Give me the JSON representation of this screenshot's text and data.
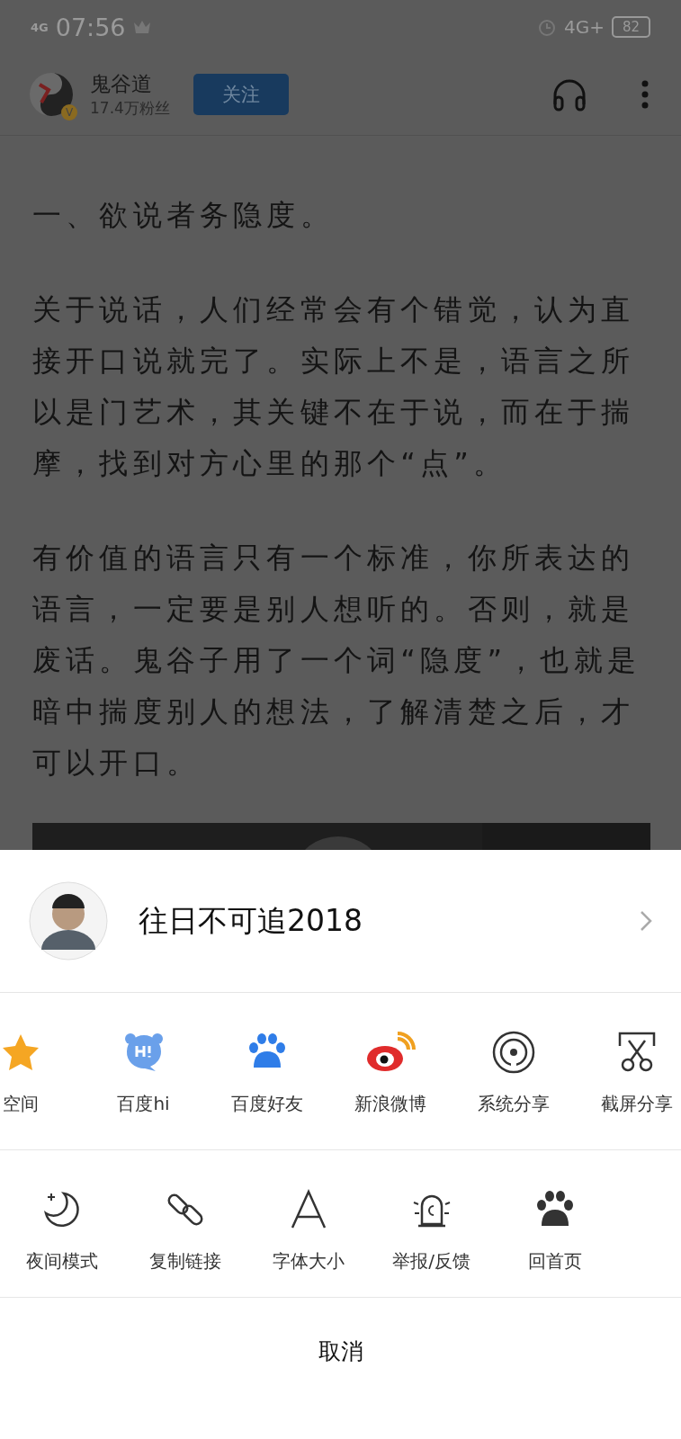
{
  "status_bar": {
    "signal": "4G",
    "time": "07:56",
    "network": "4G+",
    "battery": "82"
  },
  "header": {
    "author": "鬼谷道",
    "fans": "17.4万粉丝",
    "verified_badge": "V",
    "follow_button": "关注"
  },
  "article": {
    "heading": "一、欲说者务隐度。",
    "paragraphs": [
      "关于说话，人们经常会有个错觉，认为直接开口说就完了。实际上不是，语言之所以是门艺术，其关键不在于说，而在于揣摩，找到对方心里的那个“点”。",
      "有价值的语言只有一个标准，你所表达的语言，一定要是别人想听的。否则，就是废话。鬼谷子用了一个词“隐度”，也就是暗中揣度别人的想法，了解清楚之后，才可以开口。"
    ]
  },
  "share_sheet": {
    "account": {
      "name": "往日不可追2018"
    },
    "share_targets": [
      {
        "kind": "qzone",
        "label": "空间"
      },
      {
        "kind": "hi",
        "label": "百度hi"
      },
      {
        "kind": "baidu",
        "label": "百度好友"
      },
      {
        "kind": "weibo",
        "label": "新浪微博"
      },
      {
        "kind": "system",
        "label": "系统分享"
      },
      {
        "kind": "screenshot",
        "label": "截屏分享"
      }
    ],
    "tools": [
      {
        "kind": "night",
        "label": "夜间模式"
      },
      {
        "kind": "link",
        "label": "复制链接"
      },
      {
        "kind": "font",
        "label": "字体大小"
      },
      {
        "kind": "report",
        "label": "举报/反馈"
      },
      {
        "kind": "home",
        "label": "回首页"
      }
    ],
    "cancel": "取消"
  }
}
